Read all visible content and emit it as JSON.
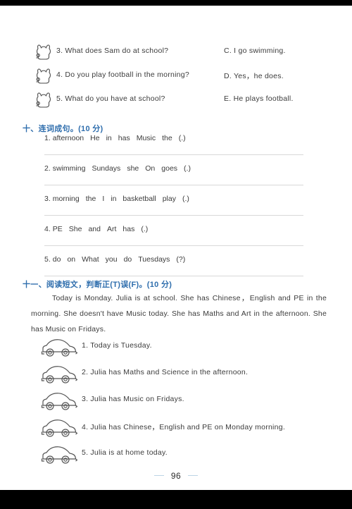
{
  "page": {
    "number": "96",
    "footer_rule_color": "#bcd4e6",
    "accent_color": "#2f6ead",
    "text_color": "#3b3b3b",
    "rule_color": "#d8d8d8"
  },
  "matching_exercise": {
    "icon": "bunny-icon",
    "items": [
      {
        "question": "3. What does Sam do at school?",
        "answer": "C. I go swimming."
      },
      {
        "question": "4. Do you play football in the morning?",
        "answer": "D. Yes，he does."
      },
      {
        "question": "5. What do you have at school?",
        "answer": "E. He plays football."
      }
    ]
  },
  "section_ten": {
    "heading": "十、连词成句。(10 分)",
    "items": [
      {
        "number": "1.",
        "words": [
          "afternoon",
          "He",
          "in",
          "has",
          "Music",
          "the",
          "(.)"
        ]
      },
      {
        "number": "2.",
        "words": [
          "swimming",
          "Sundays",
          "she",
          "On",
          "goes",
          "(.)"
        ]
      },
      {
        "number": "3.",
        "words": [
          "morning",
          "the",
          "I",
          "in",
          "basketball",
          "play",
          "(.)"
        ]
      },
      {
        "number": "4.",
        "words": [
          "PE",
          "She",
          "and",
          "Art",
          "has",
          "(.)"
        ]
      },
      {
        "number": "5.",
        "words": [
          "do",
          "on",
          "What",
          "you",
          "do",
          "Tuesdays",
          "(?)"
        ]
      }
    ]
  },
  "section_eleven": {
    "heading": "十一、阅读短文，判断正(T)误(F)。(10 分)",
    "passage": "Today is Monday. Julia is at school. She has Chinese，English and PE in the morning. She doesn't have Music today. She has Maths and Art in the afternoon. She has Music on Fridays.",
    "icon": "car-icon",
    "statements": [
      "1. Today is Tuesday.",
      "2. Julia has Maths and Science in the afternoon.",
      "3. Julia has Music on Fridays.",
      "4. Julia has Chinese，English and PE on Monday morning.",
      "5. Julia is at home today."
    ]
  }
}
